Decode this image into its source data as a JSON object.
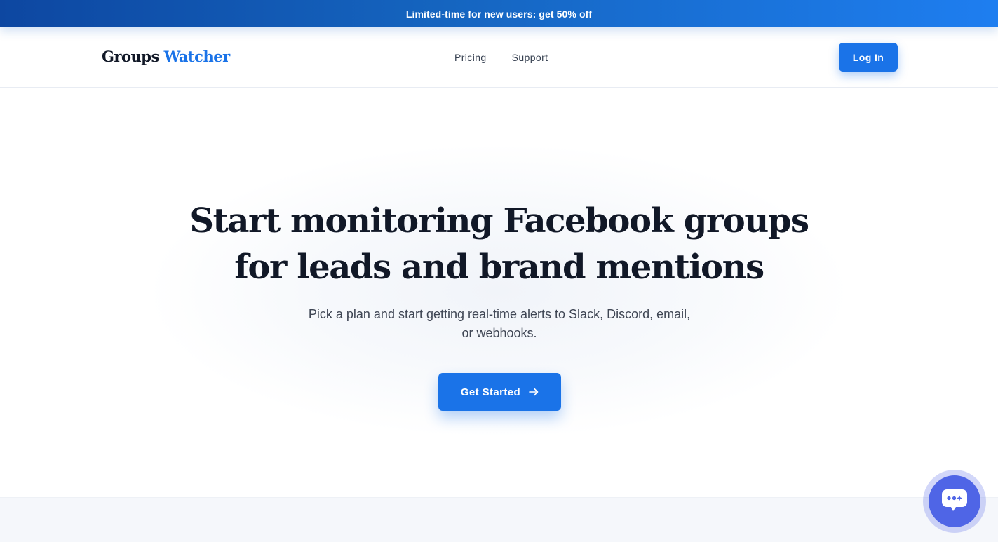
{
  "promo": {
    "text": "Limited-time for new users: get 50% off"
  },
  "nav": {
    "logo_part1": "Groups",
    "logo_part2": "Watcher",
    "links": [
      {
        "label": "Pricing"
      },
      {
        "label": "Support"
      }
    ],
    "login_label": "Log In"
  },
  "hero": {
    "title_line1": "Start monitoring Facebook groups",
    "title_line2": "for leads and brand mentions",
    "subtitle": "Pick a plan and start getting real-time alerts to Slack, Discord, email, or webhooks.",
    "cta_label": "Get Started",
    "cta_icon": "arrow-right-icon"
  },
  "chat": {
    "icon": "chat-bubble-icon"
  },
  "colors": {
    "primary": "#1a73e8",
    "promo_start": "#0d47a1",
    "promo_end": "#1e7ef0",
    "heading": "#111827",
    "body_text": "#3f4654",
    "chat": "#4f65e6"
  }
}
